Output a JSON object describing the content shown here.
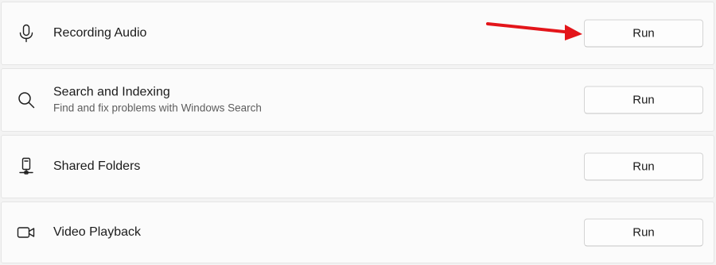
{
  "items": [
    {
      "icon": "microphone-icon",
      "title": "Recording Audio",
      "subtitle": "",
      "button_label": "Run"
    },
    {
      "icon": "search-icon",
      "title": "Search and Indexing",
      "subtitle": "Find and fix problems with Windows Search",
      "button_label": "Run"
    },
    {
      "icon": "shared-folders-icon",
      "title": "Shared Folders",
      "subtitle": "",
      "button_label": "Run"
    },
    {
      "icon": "video-camera-icon",
      "title": "Video Playback",
      "subtitle": "",
      "button_label": "Run"
    }
  ],
  "annotation": {
    "icon": "red-arrow-icon",
    "color": "#e3151a",
    "points_to": "Recording Audio Run button"
  },
  "colors": {
    "card_background": "#fbfbfb",
    "page_background": "#f3f3f3",
    "button_background": "#fdfdfd"
  }
}
